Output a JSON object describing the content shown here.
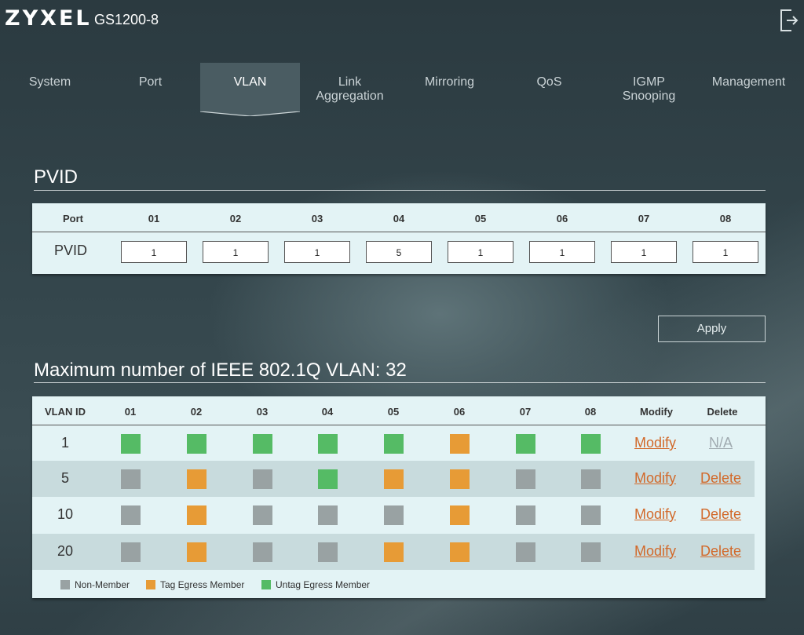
{
  "brand": {
    "logo": "ZYXEL",
    "model": "GS1200-8"
  },
  "icons": {
    "logout": "logout-icon"
  },
  "nav": {
    "items": [
      {
        "label": "System"
      },
      {
        "label": "Port"
      },
      {
        "label": "VLAN",
        "active": true
      },
      {
        "label": "Link\nAggregation"
      },
      {
        "label": "Mirroring"
      },
      {
        "label": "QoS"
      },
      {
        "label": "IGMP\nSnooping"
      },
      {
        "label": "Management"
      }
    ]
  },
  "pvid": {
    "title": "PVID",
    "header_port": "Port",
    "row_label": "PVID",
    "ports": [
      "01",
      "02",
      "03",
      "04",
      "05",
      "06",
      "07",
      "08"
    ],
    "values": [
      "1",
      "1",
      "1",
      "5",
      "1",
      "1",
      "1",
      "1"
    ]
  },
  "apply_label": "Apply",
  "vlan": {
    "title": "Maximum number of IEEE 802.1Q VLAN: 32",
    "headers": {
      "vlan_id": "VLAN ID",
      "modify": "Modify",
      "delete": "Delete"
    },
    "ports": [
      "01",
      "02",
      "03",
      "04",
      "05",
      "06",
      "07",
      "08"
    ],
    "rows": [
      {
        "id": "1",
        "members": [
          "untag",
          "untag",
          "untag",
          "untag",
          "untag",
          "tag",
          "untag",
          "untag"
        ],
        "modify": "Modify",
        "delete": "N/A",
        "delete_enabled": false
      },
      {
        "id": "5",
        "members": [
          "non",
          "tag",
          "non",
          "untag",
          "tag",
          "tag",
          "non",
          "non"
        ],
        "modify": "Modify",
        "delete": "Delete",
        "delete_enabled": true
      },
      {
        "id": "10",
        "members": [
          "non",
          "tag",
          "non",
          "non",
          "non",
          "tag",
          "non",
          "non"
        ],
        "modify": "Modify",
        "delete": "Delete",
        "delete_enabled": true
      },
      {
        "id": "20",
        "members": [
          "non",
          "tag",
          "non",
          "non",
          "tag",
          "tag",
          "non",
          "non"
        ],
        "modify": "Modify",
        "delete": "Delete",
        "delete_enabled": true
      }
    ],
    "legend": [
      {
        "key": "non",
        "label": "Non-Member"
      },
      {
        "key": "tag",
        "label": "Tag Egress Member"
      },
      {
        "key": "untag",
        "label": "Untag Egress Member"
      }
    ]
  },
  "colors": {
    "non": "#99a2a3",
    "tag": "#e79b36",
    "untag": "#55bb65",
    "link": "#d2692a",
    "link_disabled": "#a0aab0"
  }
}
